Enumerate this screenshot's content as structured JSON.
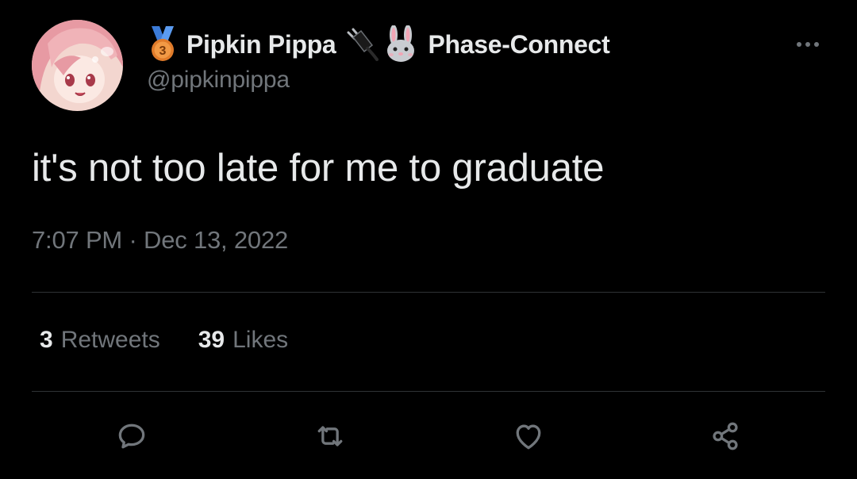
{
  "author": {
    "display_name": "Pipkin Pippa",
    "affiliation": "Phase-Connect",
    "handle": "@pipkinpippa",
    "badge_icons": [
      "third-place-medal-icon",
      "electric-plug-icon",
      "rabbit-face-icon"
    ]
  },
  "tweet": {
    "text": "it's not too late for me to graduate",
    "time": "7:07 PM",
    "separator": "·",
    "date": "Dec 13, 2022"
  },
  "stats": {
    "retweets_count": "3",
    "retweets_label": "Retweets",
    "likes_count": "39",
    "likes_label": "Likes"
  },
  "actions": [
    "reply-icon",
    "retweet-icon",
    "like-icon",
    "share-icon"
  ],
  "colors": {
    "background": "#000000",
    "primary_text": "#e7e9ea",
    "secondary_text": "#71767b",
    "divider": "#2f3336"
  }
}
